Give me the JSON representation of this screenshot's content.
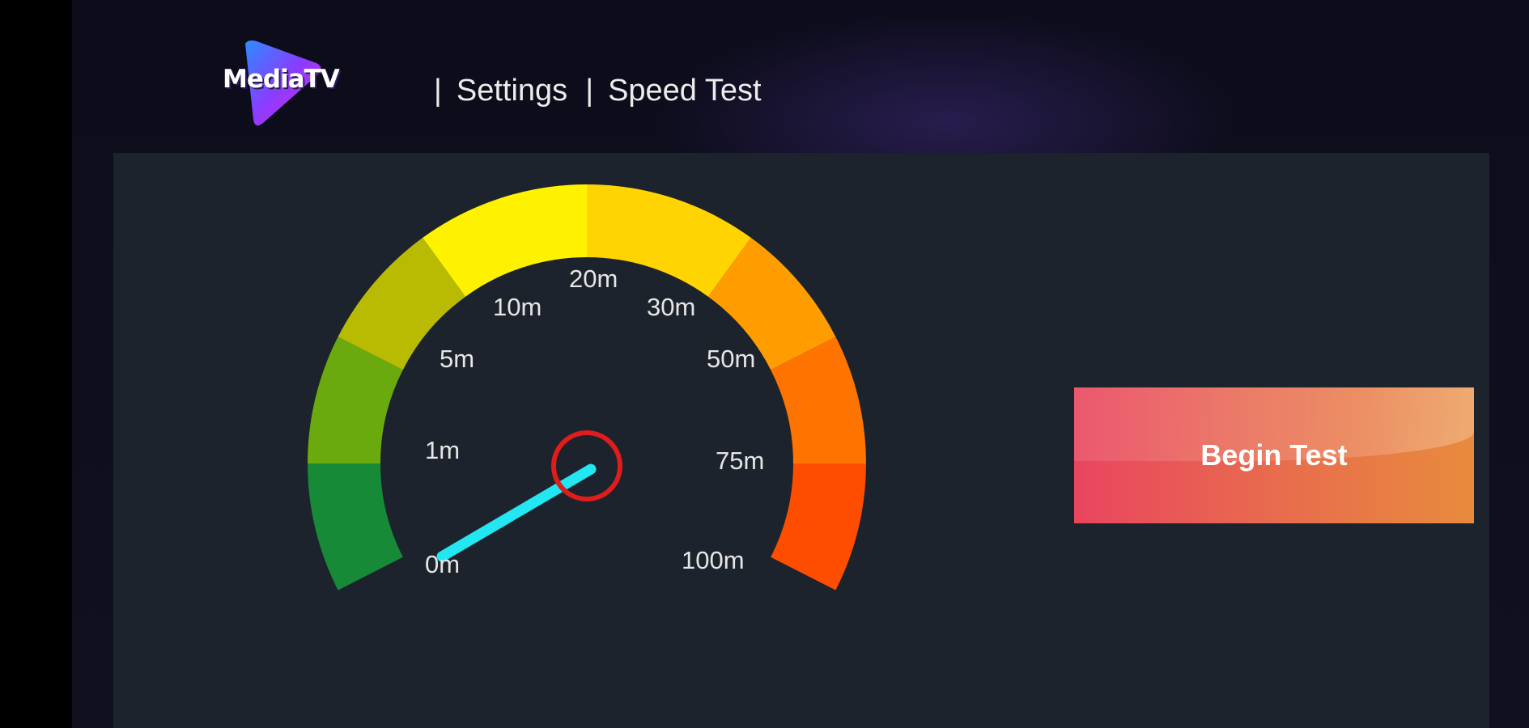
{
  "header": {
    "logo_text": "MediaTV",
    "breadcrumb": {
      "separator": "|",
      "items": [
        "Settings",
        "Speed Test"
      ]
    }
  },
  "speed_gauge": {
    "scale_labels": [
      "0m",
      "1m",
      "5m",
      "10m",
      "20m",
      "30m",
      "50m",
      "75m",
      "100m"
    ],
    "needle_value": "0m",
    "band_colors": [
      "#178a37",
      "#6aaa0e",
      "#b9bb02",
      "#fff200",
      "#ffd400",
      "#ff9d00",
      "#ff7400",
      "#ff4d00"
    ],
    "needle_color": "#22e6f2",
    "hub_color": "#e01c1c"
  },
  "actions": {
    "begin_test_label": "Begin Test"
  },
  "colors": {
    "panel": "#1c232c",
    "button_start": "#e9455f",
    "button_end": "#e88b3d"
  }
}
